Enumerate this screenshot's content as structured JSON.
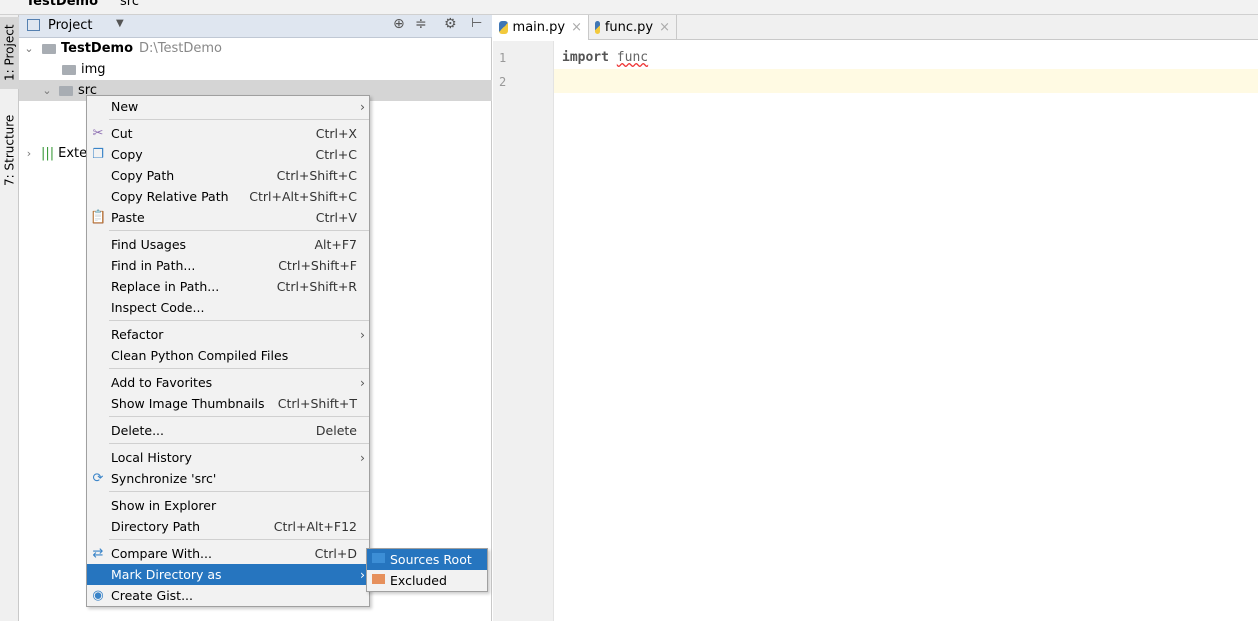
{
  "breadcrumb": {
    "project": "TestDemo",
    "folder": "src"
  },
  "side_tabs": {
    "project": "1: Project",
    "structure": "7: Structure"
  },
  "project_panel": {
    "title": "Project"
  },
  "tree": {
    "root": "TestDemo",
    "root_path": "D:\\TestDemo",
    "img": "img",
    "src": "src",
    "external": "Exte"
  },
  "editor": {
    "tabs": [
      {
        "label": "main.py",
        "active": true
      },
      {
        "label": "func.py",
        "active": false
      }
    ],
    "lines": [
      "1",
      "2"
    ],
    "keyword": "import",
    "module": "func"
  },
  "menu": {
    "items": [
      {
        "label": "New",
        "submenu": true
      },
      {
        "sep": true
      },
      {
        "label": "Cut",
        "shortcut": "Ctrl+X",
        "icon": "✂"
      },
      {
        "label": "Copy",
        "shortcut": "Ctrl+C",
        "icon": "❐"
      },
      {
        "label": "Copy Path",
        "shortcut": "Ctrl+Shift+C"
      },
      {
        "label": "Copy Relative Path",
        "shortcut": "Ctrl+Alt+Shift+C"
      },
      {
        "label": "Paste",
        "shortcut": "Ctrl+V",
        "icon": "📋"
      },
      {
        "sep": true
      },
      {
        "label": "Find Usages",
        "shortcut": "Alt+F7"
      },
      {
        "label": "Find in Path...",
        "shortcut": "Ctrl+Shift+F"
      },
      {
        "label": "Replace in Path...",
        "shortcut": "Ctrl+Shift+R"
      },
      {
        "label": "Inspect Code..."
      },
      {
        "sep": true
      },
      {
        "label": "Refactor",
        "submenu": true
      },
      {
        "label": "Clean Python Compiled Files"
      },
      {
        "sep": true
      },
      {
        "label": "Add to Favorites",
        "submenu": true
      },
      {
        "label": "Show Image Thumbnails",
        "shortcut": "Ctrl+Shift+T"
      },
      {
        "sep": true
      },
      {
        "label": "Delete...",
        "shortcut": "Delete"
      },
      {
        "sep": true
      },
      {
        "label": "Local History",
        "submenu": true
      },
      {
        "label": "Synchronize 'src'",
        "icon": "⟳"
      },
      {
        "sep": true
      },
      {
        "label": "Show in Explorer"
      },
      {
        "label": "Directory Path",
        "shortcut": "Ctrl+Alt+F12"
      },
      {
        "sep": true
      },
      {
        "label": "Compare With...",
        "shortcut": "Ctrl+D",
        "icon": "⇄"
      },
      {
        "label": "Mark Directory as",
        "submenu": true,
        "selected": true
      },
      {
        "label": "Create Gist...",
        "icon": "◉"
      }
    ]
  },
  "submenu": {
    "items": [
      {
        "label": "Sources Root",
        "color": "#3c8ed6",
        "selected": true
      },
      {
        "label": "Excluded",
        "color": "#e6905c"
      }
    ]
  },
  "colors": {
    "selection": "#2675bf",
    "current_line": "#fffae3"
  }
}
